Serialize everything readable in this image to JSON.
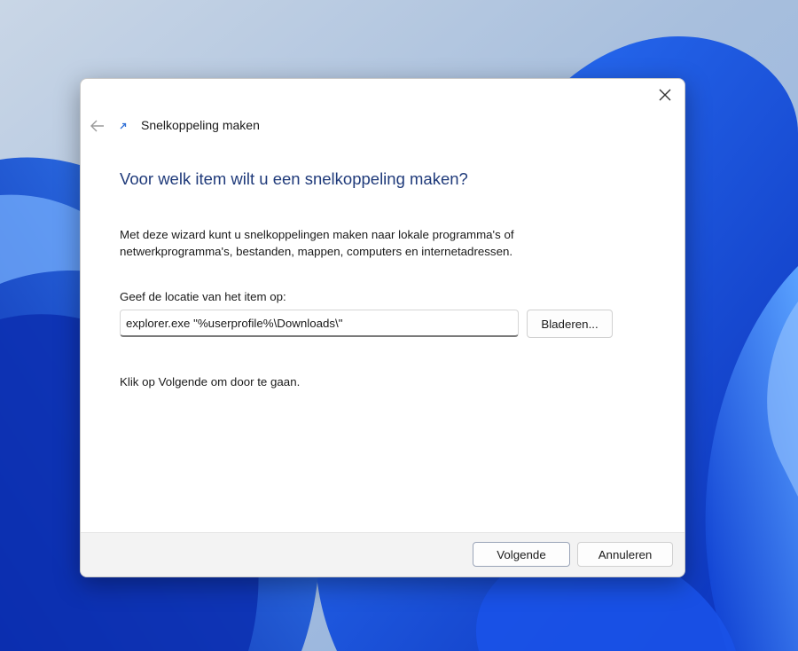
{
  "window": {
    "title": "Snelkoppeling maken"
  },
  "icons": {
    "back": "back-arrow-icon",
    "close": "close-icon",
    "shortcut": "shortcut-arrow-icon"
  },
  "wizard": {
    "heading": "Voor welk item wilt u een snelkoppeling maken?",
    "description": "Met deze wizard kunt u snelkoppelingen maken naar lokale programma's of netwerkprogramma's, bestanden, mappen, computers en internetadressen.",
    "location_label": "Geef de locatie van het item op:",
    "location_value": "explorer.exe \"%userprofile%\\Downloads\\\"",
    "browse_label": "Bladeren...",
    "hint": "Klik op Volgende om door te gaan."
  },
  "footer": {
    "next_label": "Volgende",
    "cancel_label": "Annuleren"
  },
  "colors": {
    "heading": "#1f3a7a",
    "wallpaper_primary": "#1f5fe0",
    "wallpaper_light": "#9fb6d6"
  }
}
